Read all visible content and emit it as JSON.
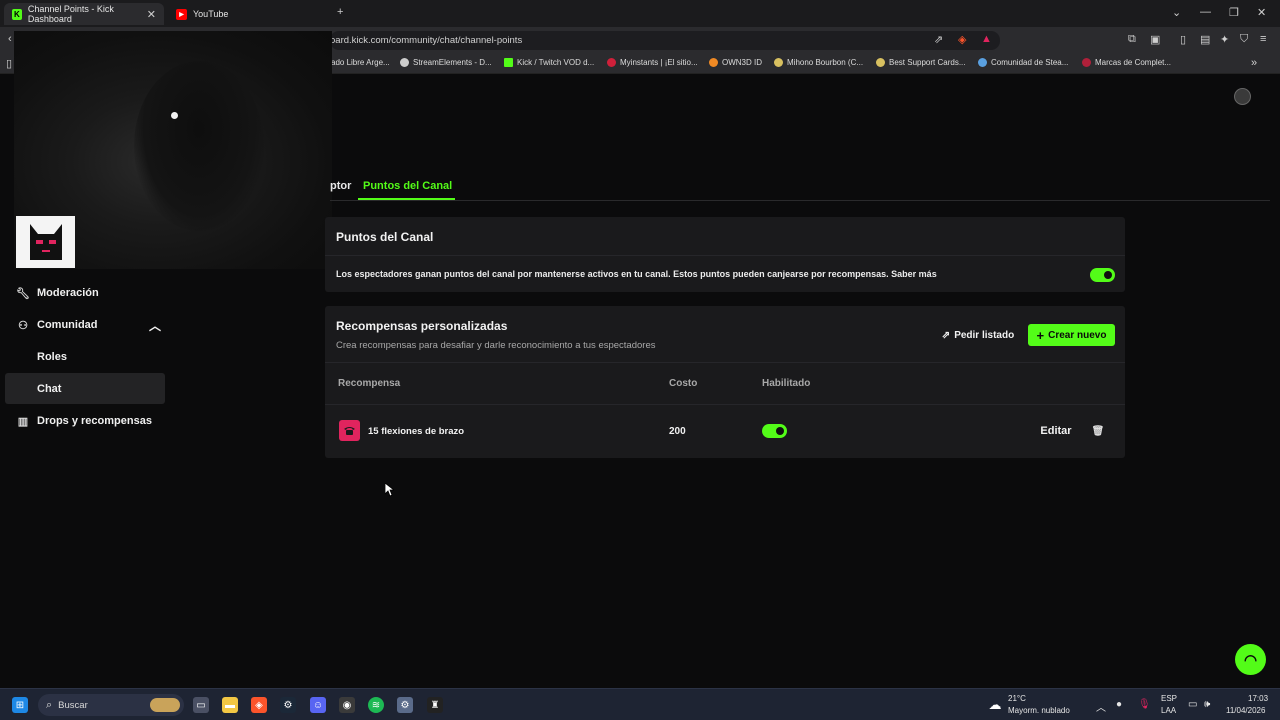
{
  "browser": {
    "tabs": [
      {
        "title": "Channel Points - Kick Dashboard",
        "active": true
      },
      {
        "title": "YouTube",
        "active": false
      }
    ],
    "url": "oard.kick.com/community/chat/channel-points",
    "bookmarks": [
      "ado Libre Arge...",
      "StreamElements - D...",
      "Kick / Twitch VOD d...",
      "Myinstants | ¡El sitio...",
      "OWN3D ID",
      "Mihono Bourbon (C...",
      "Best Support Cards...",
      "Comunidad de Stea...",
      "Marcas de Complet..."
    ]
  },
  "sidebar": {
    "items": [
      {
        "label": "Moderación",
        "icon": "wrench-icon"
      },
      {
        "label": "Comunidad",
        "icon": "community-icon"
      },
      {
        "label": "Drops y recompensas",
        "icon": "drops-icon"
      }
    ],
    "subitems": [
      {
        "label": "Roles"
      },
      {
        "label": "Chat"
      }
    ]
  },
  "tabs": {
    "prev": "ptor",
    "active": "Puntos del Canal"
  },
  "channel_points": {
    "title": "Puntos del Canal",
    "description": "Los espectadores ganan puntos del canal por mantenerse activos en tu canal. Estos puntos pueden canjearse por recompensas. Saber más",
    "enabled": true
  },
  "rewards": {
    "title": "Recompensas personalizadas",
    "subtitle": "Crea recompensas para desafiar y darle reconocimiento a tus espectadores",
    "request_label": "Pedir listado",
    "create_label": "Crear nuevo",
    "columns": [
      "Recompensa",
      "Costo",
      "Habilitado"
    ],
    "rows": [
      {
        "name": "15 flexiones de brazo",
        "cost": "200",
        "enabled": true,
        "edit_label": "Editar"
      }
    ]
  },
  "taskbar": {
    "search_placeholder": "Buscar",
    "weather_temp": "21°C",
    "weather_desc": "Mayorm. nublado",
    "lang_top": "ESP",
    "lang_bottom": "LAA",
    "time": "17:03",
    "date": "11/04/2026"
  },
  "colors": {
    "accent": "#53fc18",
    "reward_icon": "#e0245e"
  }
}
